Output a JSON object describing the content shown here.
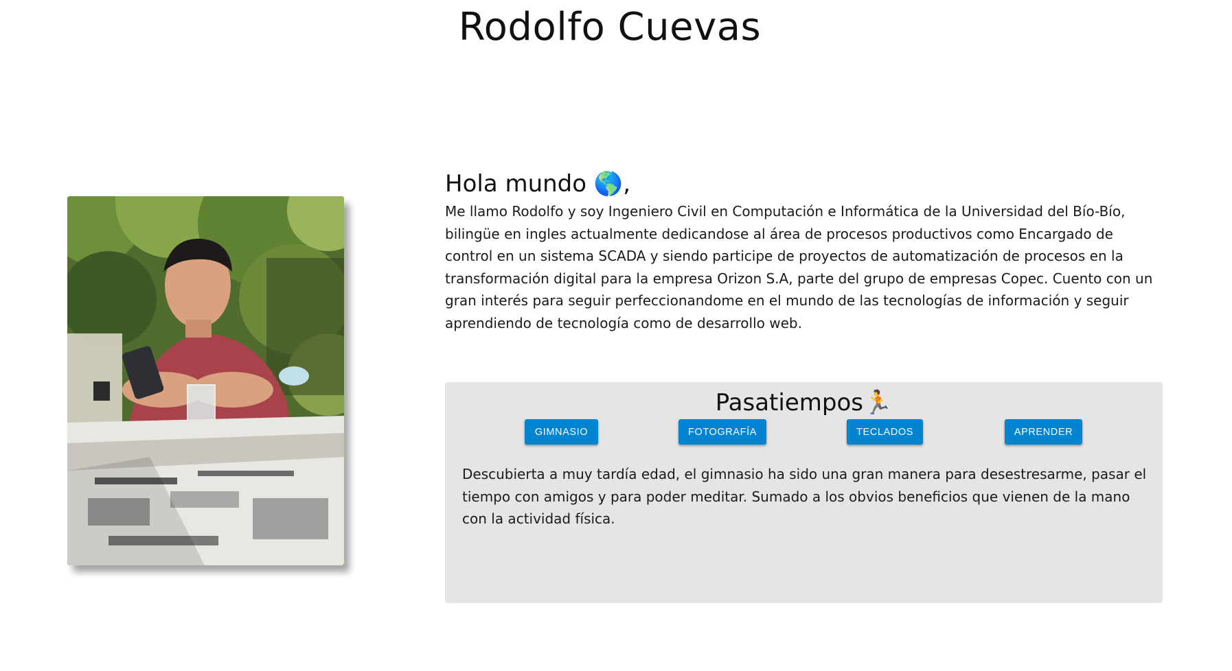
{
  "header": {
    "name": "Rodolfo Cuevas"
  },
  "profile_photo": {
    "alt": "Rodolfo Cuevas"
  },
  "intro": {
    "heading": "Hola mundo 🌎,",
    "body": "Me llamo Rodolfo y soy Ingeniero Civil en Computación e Informática de la Universidad del Bío-Bío, bilingüe en ingles actualmente dedicandose al área de procesos productivos como Encargado de control en un sistema SCADA y siendo participe de proyectos de automatización de procesos en la transformación digital para la empresa Orizon S.A, parte del grupo de empresas Copec. Cuento con un gran interés para seguir perfeccionandome en el mundo de las tecnologías de información y seguir aprendiendo de tecnología como de desarrollo web."
  },
  "hobbies": {
    "title": "Pasatiempos🏃",
    "buttons": [
      {
        "label": "Gimnasio"
      },
      {
        "label": "Fotografía"
      },
      {
        "label": "Teclados"
      },
      {
        "label": "Aprender"
      }
    ],
    "active_description": "Descubierta a muy tardía edad, el gimnasio ha sido una gran manera para desestresarme, pasar el tiempo con amigos y para poder meditar. Sumado a los obvios beneficios que vienen de la mano con la actividad física."
  },
  "colors": {
    "button_bg": "#0284d1",
    "panel_bg": "#e5e5e5"
  }
}
